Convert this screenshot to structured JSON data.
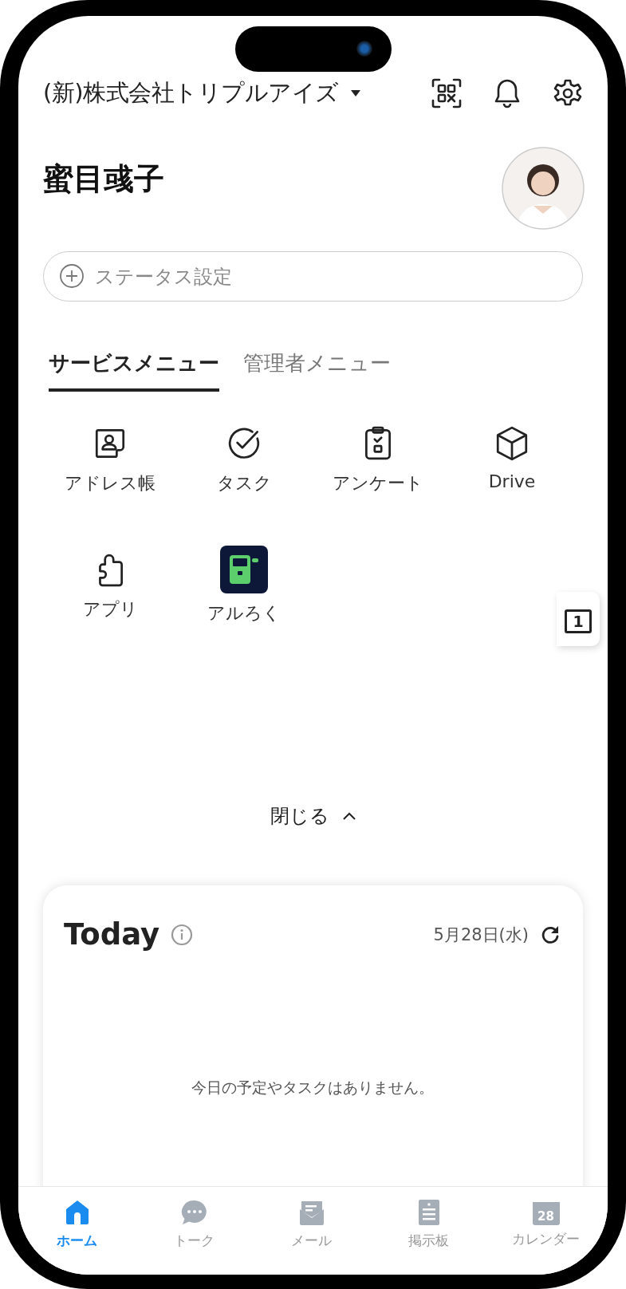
{
  "header": {
    "organization": "(新)株式会社トリプルアイズ"
  },
  "user": {
    "name": "蜜目彧子"
  },
  "status_field": {
    "placeholder": "ステータス設定"
  },
  "tabs": [
    {
      "label": "サービスメニュー",
      "selected": true
    },
    {
      "label": "管理者メニュー",
      "selected": false
    }
  ],
  "services": [
    {
      "label": "アドレス帳",
      "kind": "contact"
    },
    {
      "label": "タスク",
      "kind": "task"
    },
    {
      "label": "アンケート",
      "kind": "survey"
    },
    {
      "label": "Drive",
      "kind": "drive"
    },
    {
      "label": "アプリ",
      "kind": "apps"
    },
    {
      "label": "アルろく",
      "kind": "device"
    }
  ],
  "side_tab": {
    "count": "1"
  },
  "collapse": {
    "label": "閉じる"
  },
  "today": {
    "title": "Today",
    "date": "5月28日(水)",
    "empty_message": "今日の予定やタスクはありません。"
  },
  "bottom_nav": [
    {
      "label": "ホーム",
      "kind": "home",
      "selected": true
    },
    {
      "label": "トーク",
      "kind": "talk",
      "selected": false
    },
    {
      "label": "メール",
      "kind": "mail",
      "selected": false
    },
    {
      "label": "掲示板",
      "kind": "board",
      "selected": false
    },
    {
      "label": "カレンダー",
      "kind": "calendar",
      "selected": false,
      "icon_text": "28"
    }
  ]
}
